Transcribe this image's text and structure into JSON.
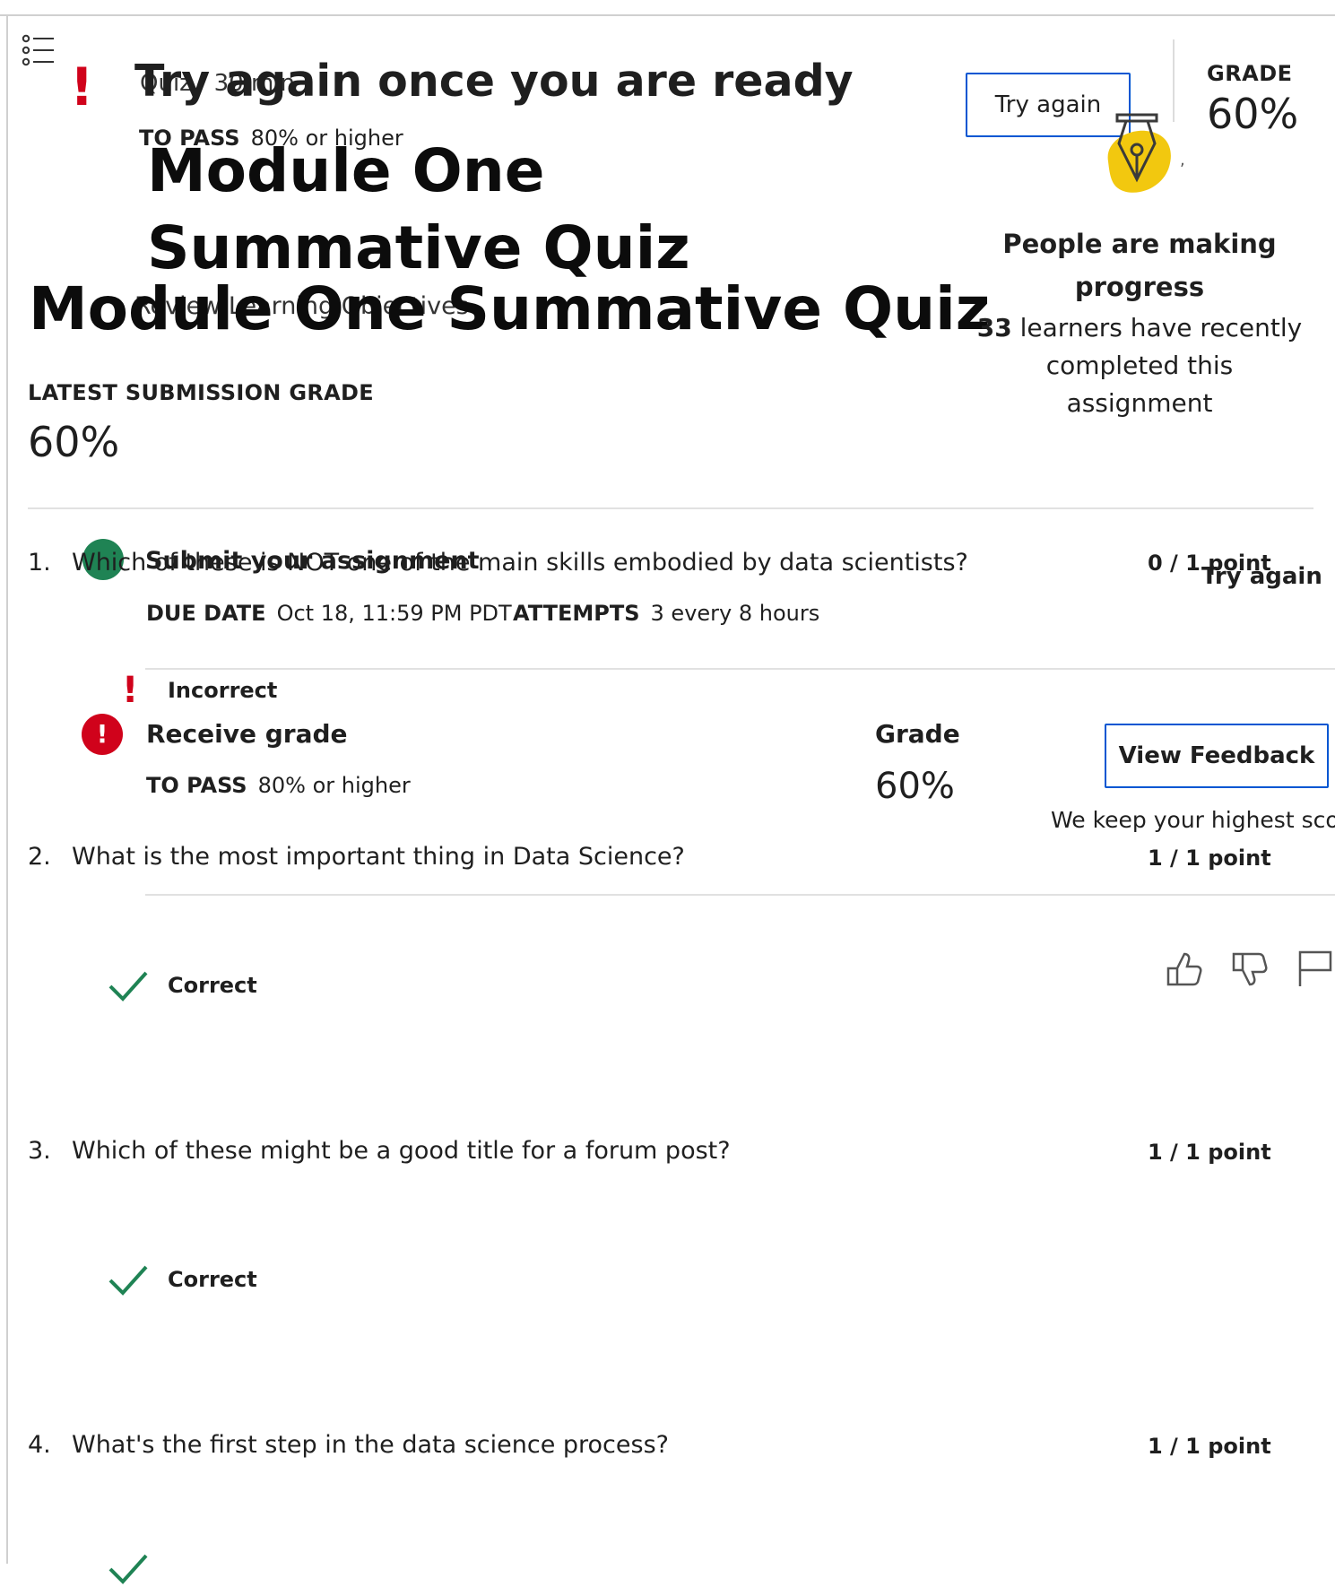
{
  "header": {
    "status_title": "Try again once you are ready",
    "quiz_label": "Quiz · 30 min",
    "to_pass_label": "TO PASS",
    "to_pass_value": "80% or higher",
    "title_wrapped": "Module One Summative Quiz",
    "review_link": "Review Learning Objectives",
    "title": "Module One Summative Quiz"
  },
  "latest_submission": {
    "label": "LATEST SUBMISSION GRADE",
    "value": "60%"
  },
  "summary_panel": {
    "try_again_button": "Try again",
    "grade_label": "GRADE",
    "grade_value": "60%",
    "badge_icon": "pen-nib-icon",
    "comma": ",",
    "progress_title": "People are making progress",
    "learners_count": "33",
    "learners_text": " learners have recently completed this assignment"
  },
  "submit_section": {
    "title": "Submit your assignment",
    "due_label": "DUE DATE",
    "due_value": "Oct 18, 11:59 PM PDT",
    "attempts_label": "ATTEMPTS",
    "attempts_value": "3 every 8 hours",
    "try_again_link": "Try again"
  },
  "receive_section": {
    "title": "Receive grade",
    "to_pass_label": "TO PASS",
    "to_pass_value": "80% or higher",
    "grade_label": "Grade",
    "grade_value": "60%",
    "view_feedback_button": "View Feedback",
    "keep_note": "We keep your highest score"
  },
  "questions": [
    {
      "number": "1.",
      "text": "Which of these is NOT one of the main skills embodied by data scientists?",
      "points": "0 / 1 point",
      "result": "Incorrect"
    },
    {
      "number": "2.",
      "text": "What is the most important thing in Data Science?",
      "points": "1 / 1 point",
      "result": "Correct"
    },
    {
      "number": "3.",
      "text": "Which of these might be a good title for a forum post?",
      "points": "1 / 1 point",
      "result": "Correct"
    },
    {
      "number": "4.",
      "text": "What's the first step in the data science process?",
      "points": "1 / 1 point",
      "result": "Correct"
    }
  ],
  "colors": {
    "accent": "#0056d2",
    "error": "#d0021b",
    "success": "#1f8354",
    "badge": "#f2c80f"
  }
}
